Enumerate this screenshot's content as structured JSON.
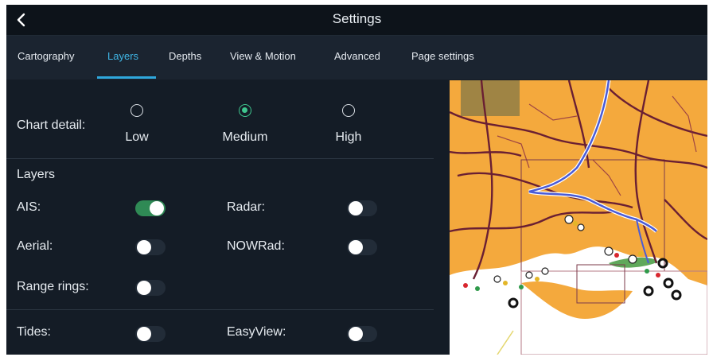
{
  "header": {
    "title": "Settings",
    "back_icon": "chevron-left-icon"
  },
  "tabs": [
    {
      "label": "Cartography"
    },
    {
      "label": "Layers",
      "active": true
    },
    {
      "label": "Depths"
    },
    {
      "label": "View & Motion"
    },
    {
      "label": "Advanced"
    },
    {
      "label": "Page settings"
    }
  ],
  "chart_detail": {
    "label": "Chart detail:",
    "options": [
      "Low",
      "Medium",
      "High"
    ],
    "selected": "Medium"
  },
  "layers": {
    "heading": "Layers",
    "ais": {
      "label": "AIS:",
      "on": true
    },
    "radar": {
      "label": "Radar:",
      "on": false
    },
    "aerial": {
      "label": "Aerial:",
      "on": false
    },
    "nowrad": {
      "label": "NOWRad:",
      "on": false
    },
    "range_rings": {
      "label": "Range rings:",
      "on": false
    },
    "tides": {
      "label": "Tides:",
      "on": false
    },
    "easyview": {
      "label": "EasyView:",
      "on": false
    }
  },
  "colors": {
    "accent": "#3fb6e6",
    "toggle_on": "#2f8a55",
    "radio_selected": "#3fc58e",
    "land": "#f4a93d",
    "water": "#ffffff"
  }
}
